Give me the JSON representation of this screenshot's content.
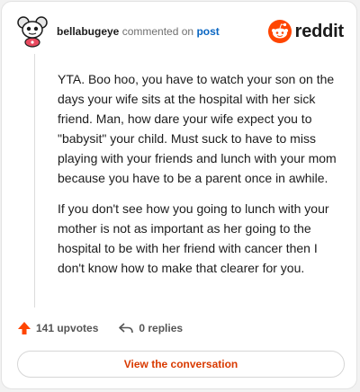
{
  "header": {
    "username": "bellabugeye",
    "action_text": "commented on",
    "post_link": "post",
    "logo_text": "reddit"
  },
  "comment": {
    "paragraphs": [
      "YTA. Boo hoo, you have to watch your son on the days your wife sits at the hospital with her sick friend. Man, how dare your wife expect you to \"babysit\" your child. Must suck to have to miss playing with your friends and lunch with your mom because you have to be a parent once in awhile.",
      "If you don't see how you going to lunch with your mother is not as important as her going to the hospital to be with her friend with cancer then I don't know how to make that clearer for you."
    ]
  },
  "actions": {
    "upvotes": "141 upvotes",
    "replies": "0 replies"
  },
  "cta": {
    "label": "View the conversation"
  },
  "colors": {
    "brand": "#ff4500",
    "link": "#0a66c2",
    "cta_text": "#d93a00"
  },
  "icons": [
    "snoo-avatar-icon",
    "reddit-logo-icon",
    "upvote-arrow-icon",
    "reply-arrow-icon"
  ]
}
